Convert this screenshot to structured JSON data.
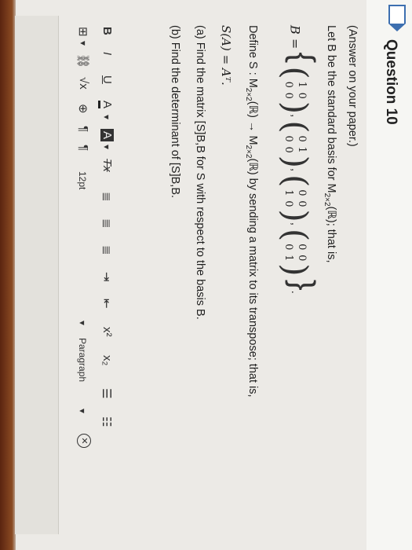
{
  "question": {
    "title": "Question 10",
    "instruction": "(Answer on your paper.)",
    "basis_intro": "Let B be the standard basis for M",
    "basis_dim": "2×2",
    "basis_field": "(ℝ); that is,",
    "basis_lhs": "B =",
    "matrices": [
      [
        "1",
        "0",
        "0",
        "0"
      ],
      [
        "0",
        "1",
        "0",
        "0"
      ],
      [
        "0",
        "0",
        "1",
        "0"
      ],
      [
        "0",
        "0",
        "0",
        "1"
      ]
    ],
    "define_prefix": "Define S : M",
    "define_mid": "(ℝ) → M",
    "define_suffix": "(ℝ) by sending a matrix to its transpose; that is,",
    "rule": "S(A) = Aᵀ.",
    "part_a": "(a) Find the matrix [S]B,B for S with respect to the basis B.",
    "part_b": "(b) Find the determinant of [S]B,B."
  },
  "toolbar": {
    "bold": "B",
    "italic": "I",
    "underline": "U",
    "font_color": "A",
    "highlight": "A",
    "clear_format": "Tx",
    "font_size": "12pt",
    "paragraph": "Paragraph",
    "superscript": "x²",
    "subscript": "x₂"
  },
  "colors": {
    "flag": "#3d6fb0",
    "text": "#1e1e1e"
  }
}
